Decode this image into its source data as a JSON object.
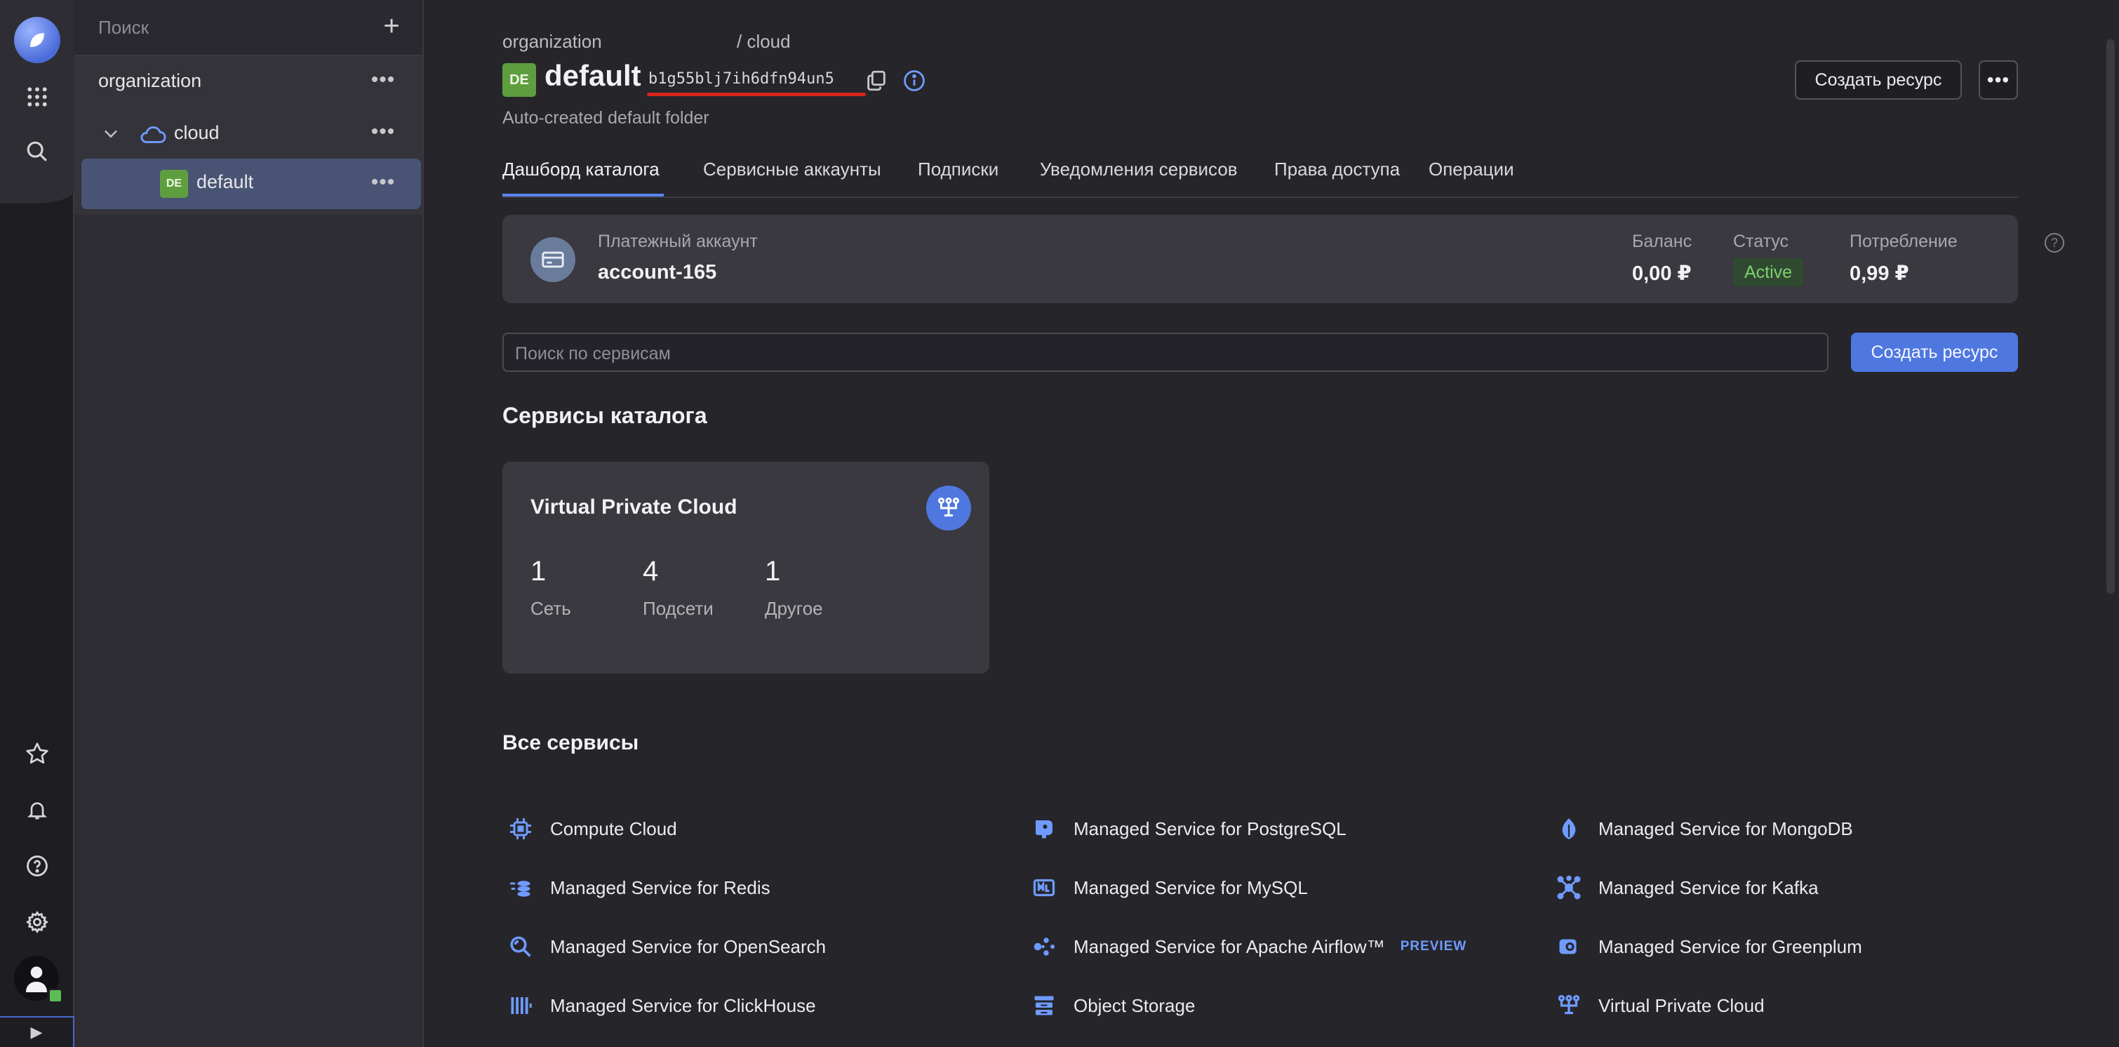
{
  "rail": {
    "icons": [
      "logo-icon",
      "apps-grid-icon",
      "search-icon",
      "star-icon",
      "bell-icon",
      "help-icon",
      "gear-icon",
      "user-avatar-icon"
    ],
    "collapse_glyph": "▶"
  },
  "tree": {
    "search_label": "Поиск",
    "add_glyph": "+",
    "items": [
      {
        "label": "organization",
        "dots": "•••"
      },
      {
        "label": "cloud",
        "dots": "•••"
      },
      {
        "label": "default",
        "badge": "DE",
        "dots": "•••"
      }
    ]
  },
  "breadcrumb": {
    "org": "organization",
    "sep_cloud": "/ cloud"
  },
  "header": {
    "badge": "DE",
    "title": "default",
    "folder_id": "b1g55blj7ih6dfn94un5",
    "subtitle": "Auto-created default folder",
    "create_button": "Создать ресурс",
    "more_glyph": "•••"
  },
  "tabs": [
    {
      "label": "Дашборд каталога",
      "active": true
    },
    {
      "label": "Сервисные аккаунты"
    },
    {
      "label": "Подписки"
    },
    {
      "label": "Уведомления сервисов"
    },
    {
      "label": "Права доступа"
    },
    {
      "label": "Операции"
    }
  ],
  "billing": {
    "account_label": "Платежный аккаунт",
    "account_value": "account-165",
    "balance_label": "Баланс",
    "balance_value": "0,00 ₽",
    "status_label": "Статус",
    "status_value": "Active",
    "consumption_label": "Потребление",
    "consumption_value": "0,99 ₽",
    "help_glyph": "?"
  },
  "search": {
    "placeholder": "Поиск по сервисам",
    "create_button": "Создать ресурс"
  },
  "catalog_services": {
    "heading": "Сервисы каталога",
    "card": {
      "title": "Virtual Private Cloud",
      "stats": [
        {
          "value": "1",
          "label": "Сеть"
        },
        {
          "value": "4",
          "label": "Подсети"
        },
        {
          "value": "1",
          "label": "Другое"
        }
      ]
    }
  },
  "all_services": {
    "heading": "Все сервисы",
    "items": [
      {
        "name": "Compute Cloud",
        "icon": "chip-icon"
      },
      {
        "name": "Managed Service for PostgreSQL",
        "icon": "postgresql-icon"
      },
      {
        "name": "Managed Service for MongoDB",
        "icon": "mongodb-icon"
      },
      {
        "name": "Managed Service for Redis",
        "icon": "redis-icon"
      },
      {
        "name": "Managed Service for MySQL",
        "icon": "mysql-icon"
      },
      {
        "name": "Managed Service for Kafka",
        "icon": "kafka-icon"
      },
      {
        "name": "Managed Service for OpenSearch",
        "icon": "opensearch-icon"
      },
      {
        "name": "Managed Service for Apache Airflow™",
        "icon": "airflow-icon",
        "badge": "PREVIEW"
      },
      {
        "name": "Managed Service for Greenplum",
        "icon": "greenplum-icon"
      },
      {
        "name": "Managed Service for ClickHouse",
        "icon": "clickhouse-icon"
      },
      {
        "name": "Object Storage",
        "icon": "object-storage-icon"
      },
      {
        "name": "Virtual Private Cloud",
        "icon": "vpc-network-icon"
      }
    ]
  },
  "colors": {
    "accent": "#4e77e0",
    "highlight_underline": "#d9261c",
    "status_active": "#7fcf6e",
    "folder_badge": "#5f9e3e"
  }
}
